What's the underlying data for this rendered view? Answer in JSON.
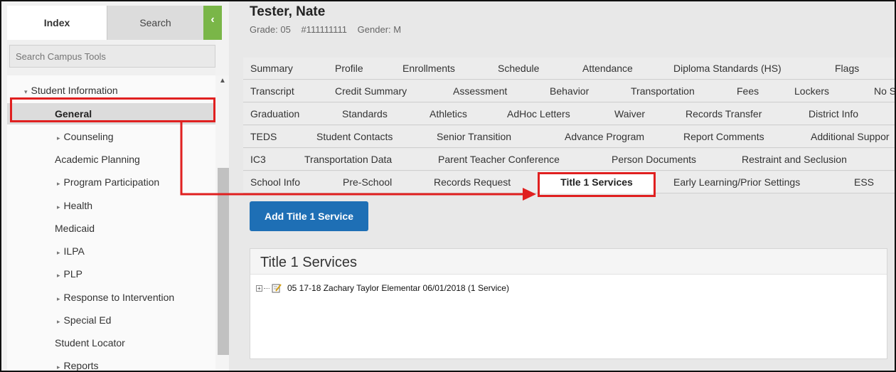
{
  "sidebar": {
    "tabs": {
      "index": "Index",
      "search": "Search"
    },
    "collapse_glyph": "‹",
    "search_placeholder": "Search Campus Tools",
    "tree": [
      {
        "label": "Student Information",
        "prefix": "▾"
      },
      {
        "label": "General",
        "prefix": ""
      },
      {
        "label": "Counseling",
        "prefix": "▸"
      },
      {
        "label": "Academic Planning",
        "prefix": ""
      },
      {
        "label": "Program Participation",
        "prefix": "▸"
      },
      {
        "label": "Health",
        "prefix": "▸"
      },
      {
        "label": "Medicaid",
        "prefix": ""
      },
      {
        "label": "ILPA",
        "prefix": "▸"
      },
      {
        "label": "PLP",
        "prefix": "▸"
      },
      {
        "label": "Response to Intervention",
        "prefix": "▸"
      },
      {
        "label": "Special Ed",
        "prefix": "▸"
      },
      {
        "label": "Student Locator",
        "prefix": ""
      },
      {
        "label": "Reports",
        "prefix": "▸"
      }
    ]
  },
  "student": {
    "name": "Tester, Nate",
    "grade": "Grade: 05",
    "id": "#111111111",
    "gender": "Gender: M"
  },
  "tab_rows": [
    [
      "Summary",
      "Profile",
      "Enrollments",
      "Schedule",
      "Attendance",
      "Diploma Standards (HS)",
      "Flags",
      "G"
    ],
    [
      "Transcript",
      "Credit Summary",
      "Assessment",
      "Behavior",
      "Transportation",
      "Fees",
      "Lockers",
      "No S"
    ],
    [
      "Graduation",
      "Standards",
      "Athletics",
      "AdHoc Letters",
      "Waiver",
      "Records Transfer",
      "District Info"
    ],
    [
      "TEDS",
      "Student Contacts",
      "Senior Transition",
      "Advance Program",
      "Report Comments",
      "Additional Suppor"
    ],
    [
      "IC3",
      "Transportation Data",
      "Parent Teacher Conference",
      "Person Documents",
      "Restraint and Seclusion"
    ],
    [
      "School Info",
      "Pre-School",
      "Records Request",
      "Title 1 Services",
      "Early Learning/Prior Settings",
      "ESS"
    ]
  ],
  "active_tab": "Title 1 Services",
  "add_button_label": "Add Title 1 Service",
  "panel": {
    "title": "Title 1 Services",
    "entries": [
      {
        "text": "05 17-18 Zachary Taylor Elementar 06/01/2018 (1 Service)",
        "icon": "note-edit-icon"
      }
    ]
  },
  "colors": {
    "accent_blue": "#1e6fb5",
    "collapse_green": "#7ab648",
    "annotation_red": "#e02020"
  }
}
